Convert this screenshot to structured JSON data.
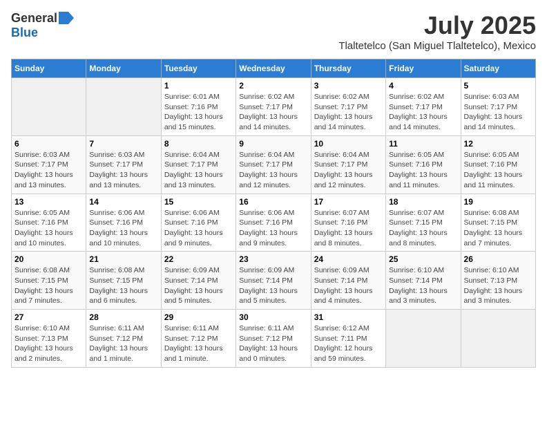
{
  "logo": {
    "general": "General",
    "blue": "Blue"
  },
  "title": "July 2025",
  "subtitle": "Tlaltetelco (San Miguel Tlaltetelco), Mexico",
  "days_header": [
    "Sunday",
    "Monday",
    "Tuesday",
    "Wednesday",
    "Thursday",
    "Friday",
    "Saturday"
  ],
  "weeks": [
    [
      {
        "num": "",
        "info": ""
      },
      {
        "num": "",
        "info": ""
      },
      {
        "num": "1",
        "info": "Sunrise: 6:01 AM\nSunset: 7:16 PM\nDaylight: 13 hours and 15 minutes."
      },
      {
        "num": "2",
        "info": "Sunrise: 6:02 AM\nSunset: 7:17 PM\nDaylight: 13 hours and 14 minutes."
      },
      {
        "num": "3",
        "info": "Sunrise: 6:02 AM\nSunset: 7:17 PM\nDaylight: 13 hours and 14 minutes."
      },
      {
        "num": "4",
        "info": "Sunrise: 6:02 AM\nSunset: 7:17 PM\nDaylight: 13 hours and 14 minutes."
      },
      {
        "num": "5",
        "info": "Sunrise: 6:03 AM\nSunset: 7:17 PM\nDaylight: 13 hours and 14 minutes."
      }
    ],
    [
      {
        "num": "6",
        "info": "Sunrise: 6:03 AM\nSunset: 7:17 PM\nDaylight: 13 hours and 13 minutes."
      },
      {
        "num": "7",
        "info": "Sunrise: 6:03 AM\nSunset: 7:17 PM\nDaylight: 13 hours and 13 minutes."
      },
      {
        "num": "8",
        "info": "Sunrise: 6:04 AM\nSunset: 7:17 PM\nDaylight: 13 hours and 13 minutes."
      },
      {
        "num": "9",
        "info": "Sunrise: 6:04 AM\nSunset: 7:17 PM\nDaylight: 13 hours and 12 minutes."
      },
      {
        "num": "10",
        "info": "Sunrise: 6:04 AM\nSunset: 7:17 PM\nDaylight: 13 hours and 12 minutes."
      },
      {
        "num": "11",
        "info": "Sunrise: 6:05 AM\nSunset: 7:16 PM\nDaylight: 13 hours and 11 minutes."
      },
      {
        "num": "12",
        "info": "Sunrise: 6:05 AM\nSunset: 7:16 PM\nDaylight: 13 hours and 11 minutes."
      }
    ],
    [
      {
        "num": "13",
        "info": "Sunrise: 6:05 AM\nSunset: 7:16 PM\nDaylight: 13 hours and 10 minutes."
      },
      {
        "num": "14",
        "info": "Sunrise: 6:06 AM\nSunset: 7:16 PM\nDaylight: 13 hours and 10 minutes."
      },
      {
        "num": "15",
        "info": "Sunrise: 6:06 AM\nSunset: 7:16 PM\nDaylight: 13 hours and 9 minutes."
      },
      {
        "num": "16",
        "info": "Sunrise: 6:06 AM\nSunset: 7:16 PM\nDaylight: 13 hours and 9 minutes."
      },
      {
        "num": "17",
        "info": "Sunrise: 6:07 AM\nSunset: 7:16 PM\nDaylight: 13 hours and 8 minutes."
      },
      {
        "num": "18",
        "info": "Sunrise: 6:07 AM\nSunset: 7:15 PM\nDaylight: 13 hours and 8 minutes."
      },
      {
        "num": "19",
        "info": "Sunrise: 6:08 AM\nSunset: 7:15 PM\nDaylight: 13 hours and 7 minutes."
      }
    ],
    [
      {
        "num": "20",
        "info": "Sunrise: 6:08 AM\nSunset: 7:15 PM\nDaylight: 13 hours and 7 minutes."
      },
      {
        "num": "21",
        "info": "Sunrise: 6:08 AM\nSunset: 7:15 PM\nDaylight: 13 hours and 6 minutes."
      },
      {
        "num": "22",
        "info": "Sunrise: 6:09 AM\nSunset: 7:14 PM\nDaylight: 13 hours and 5 minutes."
      },
      {
        "num": "23",
        "info": "Sunrise: 6:09 AM\nSunset: 7:14 PM\nDaylight: 13 hours and 5 minutes."
      },
      {
        "num": "24",
        "info": "Sunrise: 6:09 AM\nSunset: 7:14 PM\nDaylight: 13 hours and 4 minutes."
      },
      {
        "num": "25",
        "info": "Sunrise: 6:10 AM\nSunset: 7:14 PM\nDaylight: 13 hours and 3 minutes."
      },
      {
        "num": "26",
        "info": "Sunrise: 6:10 AM\nSunset: 7:13 PM\nDaylight: 13 hours and 3 minutes."
      }
    ],
    [
      {
        "num": "27",
        "info": "Sunrise: 6:10 AM\nSunset: 7:13 PM\nDaylight: 13 hours and 2 minutes."
      },
      {
        "num": "28",
        "info": "Sunrise: 6:11 AM\nSunset: 7:12 PM\nDaylight: 13 hours and 1 minute."
      },
      {
        "num": "29",
        "info": "Sunrise: 6:11 AM\nSunset: 7:12 PM\nDaylight: 13 hours and 1 minute."
      },
      {
        "num": "30",
        "info": "Sunrise: 6:11 AM\nSunset: 7:12 PM\nDaylight: 13 hours and 0 minutes."
      },
      {
        "num": "31",
        "info": "Sunrise: 6:12 AM\nSunset: 7:11 PM\nDaylight: 12 hours and 59 minutes."
      },
      {
        "num": "",
        "info": ""
      },
      {
        "num": "",
        "info": ""
      }
    ]
  ]
}
